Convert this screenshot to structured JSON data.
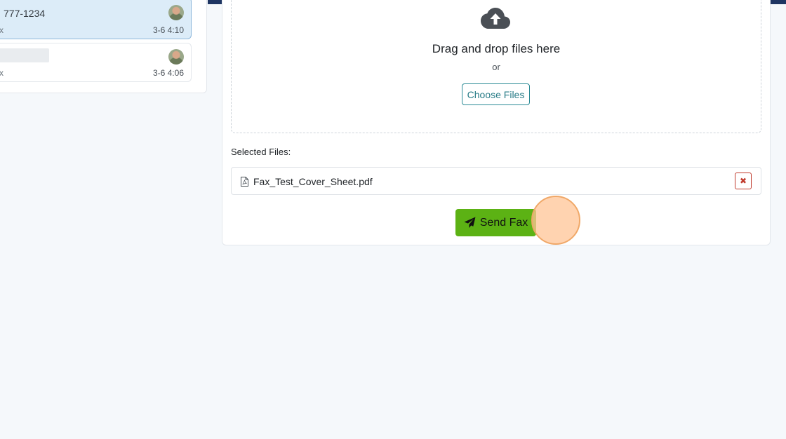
{
  "conversations": [
    {
      "title": "777-1234",
      "subtitle": "x",
      "time": "3-6 4:10"
    },
    {
      "title": "",
      "subtitle": "x",
      "time": "3-6 4:06"
    }
  ],
  "upload": {
    "icon": "cloud-upload-icon",
    "drag_text": "Drag and drop files here",
    "or_text": "or",
    "choose_label": "Choose Files"
  },
  "selected_files": {
    "label": "Selected Files:",
    "files": [
      {
        "name": "Fax_Test_Cover_Sheet.pdf",
        "icon": "file-pdf-icon",
        "remove_icon": "x-icon"
      }
    ]
  },
  "send": {
    "label": "Send Fax",
    "icon": "paper-plane-icon"
  },
  "colors": {
    "top_bar": "#1e3562",
    "send_button": "#5cb214",
    "choose_button": "#2a8a95",
    "remove_button": "#c0392b",
    "selected_conversation": "#dcecf8"
  }
}
